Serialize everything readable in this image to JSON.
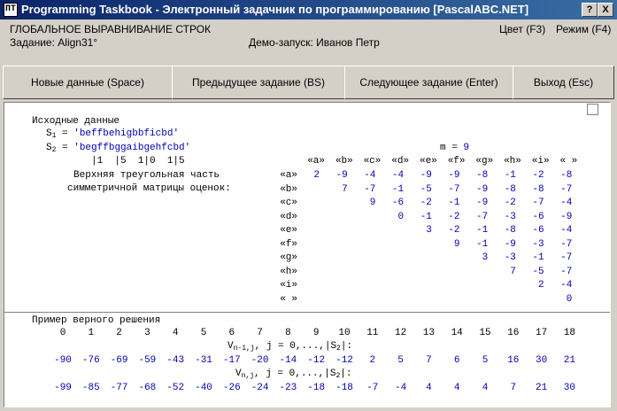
{
  "window": {
    "title": "Programming Taskbook - Электронный задачник по программированию [PascalABC.NET]",
    "app_icon": "ПТ",
    "help_btn": "?",
    "close_btn": "X"
  },
  "info": {
    "topic": "ГЛОБАЛЬНОЕ ВЫРАВНИВАНИЕ СТРОК",
    "task": "Задание: Align31°",
    "demo": "Демо-запуск: Иванов Петр",
    "color": "Цвет (F3)",
    "mode": "Режим (F4)"
  },
  "buttons": {
    "new_data": "Новые данные (Space)",
    "prev_task": "Предыдущее задание (BS)",
    "next_task": "Следующее задание (Enter)",
    "exit": "Выход (Esc)"
  },
  "input": {
    "heading": "Исходные данные",
    "s1_label": "S",
    "s1_sub": "1",
    "s1_eq": " = ",
    "s1_value": "'beffbehigbbficbd'",
    "s2_label": "S",
    "s2_sub": "2",
    "s2_eq": " = ",
    "s2_value": "'begffbggaibgehfcbd'",
    "ruler": "|1  |5  1|0  1|5",
    "m_label": "m = ",
    "m_value": "9",
    "caption1": "Верхняя треугольная часть",
    "caption2": "симметричной матрицы оценок:",
    "columns": [
      "«a»",
      "«b»",
      "«c»",
      "«d»",
      "«e»",
      "«f»",
      "«g»",
      "«h»",
      "«i»",
      "« »"
    ],
    "rows": [
      {
        "label": "«a»",
        "values": [
          "2",
          "-9",
          "-4",
          "-4",
          "-9",
          "-9",
          "-8",
          "-1",
          "-2",
          "-8"
        ]
      },
      {
        "label": "«b»",
        "values": [
          "",
          "7",
          "-7",
          "-1",
          "-5",
          "-7",
          "-9",
          "-8",
          "-8",
          "-7"
        ]
      },
      {
        "label": "«c»",
        "values": [
          "",
          "",
          "9",
          "-6",
          "-2",
          "-1",
          "-9",
          "-2",
          "-7",
          "-4"
        ]
      },
      {
        "label": "«d»",
        "values": [
          "",
          "",
          "",
          "0",
          "-1",
          "-2",
          "-7",
          "-3",
          "-6",
          "-9"
        ]
      },
      {
        "label": "«e»",
        "values": [
          "",
          "",
          "",
          "",
          "3",
          "-2",
          "-1",
          "-8",
          "-6",
          "-4"
        ]
      },
      {
        "label": "«f»",
        "values": [
          "",
          "",
          "",
          "",
          "",
          "9",
          "-1",
          "-9",
          "-3",
          "-7"
        ]
      },
      {
        "label": "«g»",
        "values": [
          "",
          "",
          "",
          "",
          "",
          "",
          "3",
          "-3",
          "-1",
          "-7"
        ]
      },
      {
        "label": "«h»",
        "values": [
          "",
          "",
          "",
          "",
          "",
          "",
          "",
          "7",
          "-5",
          "-7"
        ]
      },
      {
        "label": "«i»",
        "values": [
          "",
          "",
          "",
          "",
          "",
          "",
          "",
          "",
          "2",
          "-4"
        ]
      },
      {
        "label": "« »",
        "values": [
          "",
          "",
          "",
          "",
          "",
          "",
          "",
          "",
          "",
          "0"
        ]
      }
    ]
  },
  "solution": {
    "heading": "Пример верного решения",
    "indices": [
      "0",
      "1",
      "2",
      "3",
      "4",
      "5",
      "6",
      "7",
      "8",
      "9",
      "10",
      "11",
      "12",
      "13",
      "14",
      "15",
      "16",
      "17",
      "18"
    ],
    "v1_label": "V",
    "v1_sub": "n-1,j",
    "v1_rest": ", j = 0,...,|S",
    "v1_sub2": "2",
    "v1_end": "|:",
    "v1_values": [
      "-90",
      "-76",
      "-69",
      "-59",
      "-43",
      "-31",
      "-17",
      "-20",
      "-14",
      "-12",
      "-12",
      "2",
      "5",
      "7",
      "6",
      "5",
      "16",
      "30",
      "21"
    ],
    "v2_label": "V",
    "v2_sub": "n,j",
    "v2_rest": ", j = 0,...,|S",
    "v2_sub2": "2",
    "v2_end": "|:",
    "v2_values": [
      "-99",
      "-85",
      "-77",
      "-68",
      "-52",
      "-40",
      "-26",
      "-24",
      "-23",
      "-18",
      "-18",
      "-7",
      "-4",
      "4",
      "4",
      "4",
      "7",
      "21",
      "30"
    ]
  }
}
